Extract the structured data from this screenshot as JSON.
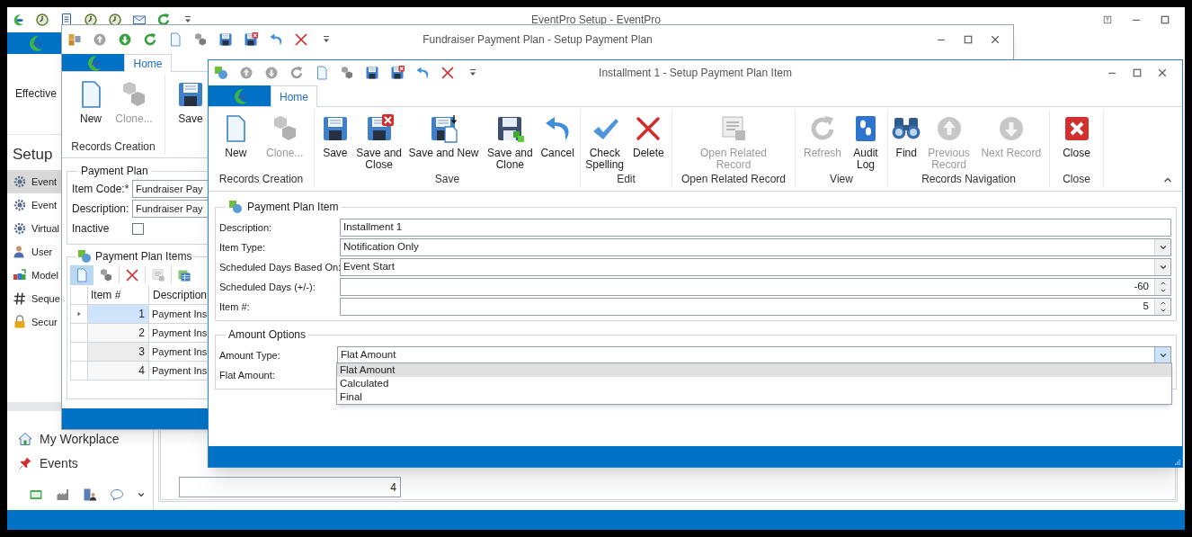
{
  "main_window": {
    "title": "EventPro Setup - EventPro",
    "sidebar": {
      "header": "Effective",
      "section": "Setup",
      "items": [
        {
          "label": "Event",
          "selected": true
        },
        {
          "label": "Event",
          "selected": false
        },
        {
          "label": "Virtual",
          "selected": false
        },
        {
          "label": "User",
          "selected": false
        },
        {
          "label": "Model",
          "selected": false
        },
        {
          "label": "Seque",
          "selected": false
        },
        {
          "label": "Secur",
          "selected": false
        }
      ],
      "nav": [
        {
          "label": "My Workplace"
        },
        {
          "label": "Events"
        }
      ]
    },
    "content": {
      "field_value": "4"
    }
  },
  "payment_plan_window": {
    "title": "Fundraiser Payment Plan - Setup Payment Plan",
    "tab": "Home",
    "ribbon_buttons": [
      {
        "label": "New",
        "disabled": false
      },
      {
        "label": "Clone...",
        "disabled": true
      },
      {
        "label": "Save",
        "disabled": false
      }
    ],
    "ribbon_group": "Records Creation",
    "payment_plan": {
      "title": "Payment Plan",
      "fields": [
        {
          "label": "Item Code:*",
          "value": "Fundraiser Pay"
        },
        {
          "label": "Description:",
          "value": "Fundraiser Pay"
        }
      ],
      "inactive": {
        "label": "Inactive",
        "checked": false
      }
    },
    "items": {
      "title": "Payment Plan Items",
      "columns": [
        "Item #",
        "Description"
      ],
      "rows": [
        {
          "item": "1",
          "description": "Payment Ins",
          "selected": true
        },
        {
          "item": "2",
          "description": "Payment Ins",
          "selected": false
        },
        {
          "item": "3",
          "description": "Payment Ins",
          "selected": false
        },
        {
          "item": "4",
          "description": "Payment Ins",
          "selected": false
        }
      ]
    }
  },
  "item_window": {
    "title": "Installment 1 - Setup Payment Plan Item",
    "tab": "Home",
    "ribbon_groups": [
      {
        "label": "Records Creation",
        "buttons": [
          {
            "label": "New",
            "disabled": false
          },
          {
            "label": "Clone...",
            "disabled": true
          }
        ]
      },
      {
        "label": "Save",
        "buttons": [
          {
            "label": "Save",
            "disabled": false
          },
          {
            "label": "Save and Close",
            "disabled": false
          },
          {
            "label": "Save and New",
            "disabled": false
          },
          {
            "label": "Save and Clone",
            "disabled": false
          },
          {
            "label": "Cancel",
            "disabled": false
          }
        ]
      },
      {
        "label": "Edit",
        "buttons": [
          {
            "label": "Check Spelling",
            "disabled": false
          },
          {
            "label": "Delete",
            "disabled": false
          }
        ]
      },
      {
        "label": "Open Related Record",
        "buttons": [
          {
            "label": "Open Related Record",
            "disabled": true
          }
        ]
      },
      {
        "label": "View",
        "buttons": [
          {
            "label": "Refresh",
            "disabled": true
          },
          {
            "label": "Audit Log",
            "disabled": false
          }
        ]
      },
      {
        "label": "Records Navigation",
        "buttons": [
          {
            "label": "Find",
            "disabled": false
          },
          {
            "label": "Previous Record",
            "disabled": true
          },
          {
            "label": "Next Record",
            "disabled": true
          }
        ]
      },
      {
        "label": "Close",
        "buttons": [
          {
            "label": "Close",
            "disabled": false
          }
        ]
      }
    ],
    "sections": [
      {
        "title": "Payment Plan Item",
        "fields": [
          {
            "label": "Description:",
            "kind": "text",
            "value": "Installment 1"
          },
          {
            "label": "Item Type:",
            "kind": "combo",
            "value": "Notification Only",
            "open": false
          },
          {
            "label": "Scheduled Days Based On:",
            "kind": "combo",
            "value": "Event Start",
            "open": false
          },
          {
            "label": "Scheduled Days (+/-):",
            "kind": "spin",
            "value": "-60"
          },
          {
            "label": "Item #:",
            "kind": "spin",
            "value": "5"
          }
        ]
      },
      {
        "title": "Amount Options",
        "fields": [
          {
            "label": "Amount Type:",
            "kind": "combo",
            "value": "Flat Amount",
            "open": true
          },
          {
            "label": "Flat Amount:"
          }
        ]
      }
    ],
    "dropdown": [
      {
        "label": "Flat Amount",
        "selected": true
      },
      {
        "label": "Calculated",
        "selected": false
      },
      {
        "label": "Final",
        "selected": false
      }
    ]
  }
}
